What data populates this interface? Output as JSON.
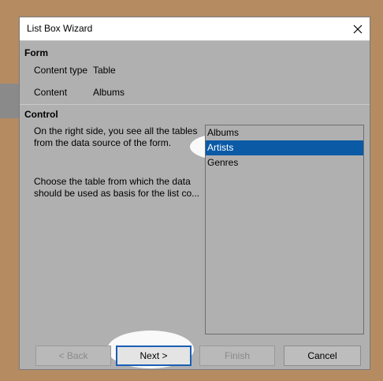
{
  "window": {
    "title": "List Box Wizard"
  },
  "form_section": {
    "heading": "Form",
    "content_type_label": "Content type",
    "content_type_value": "Table",
    "content_label": "Content",
    "content_value": "Albums"
  },
  "control_section": {
    "heading": "Control",
    "description_1": "On the right side, you see all the tables from the data source of the form.",
    "description_2": "Choose the table from which the data should be used as basis for the list co..."
  },
  "tables": {
    "items": [
      "Albums",
      "Artists",
      "Genres"
    ],
    "selected": "Artists"
  },
  "buttons": {
    "back": "< Back",
    "next": "Next >",
    "finish": "Finish",
    "cancel": "Cancel"
  },
  "colors": {
    "selection": "#0a5aa6",
    "dialog_bg": "#b0b0b0",
    "desktop_bg": "#b58b62"
  }
}
